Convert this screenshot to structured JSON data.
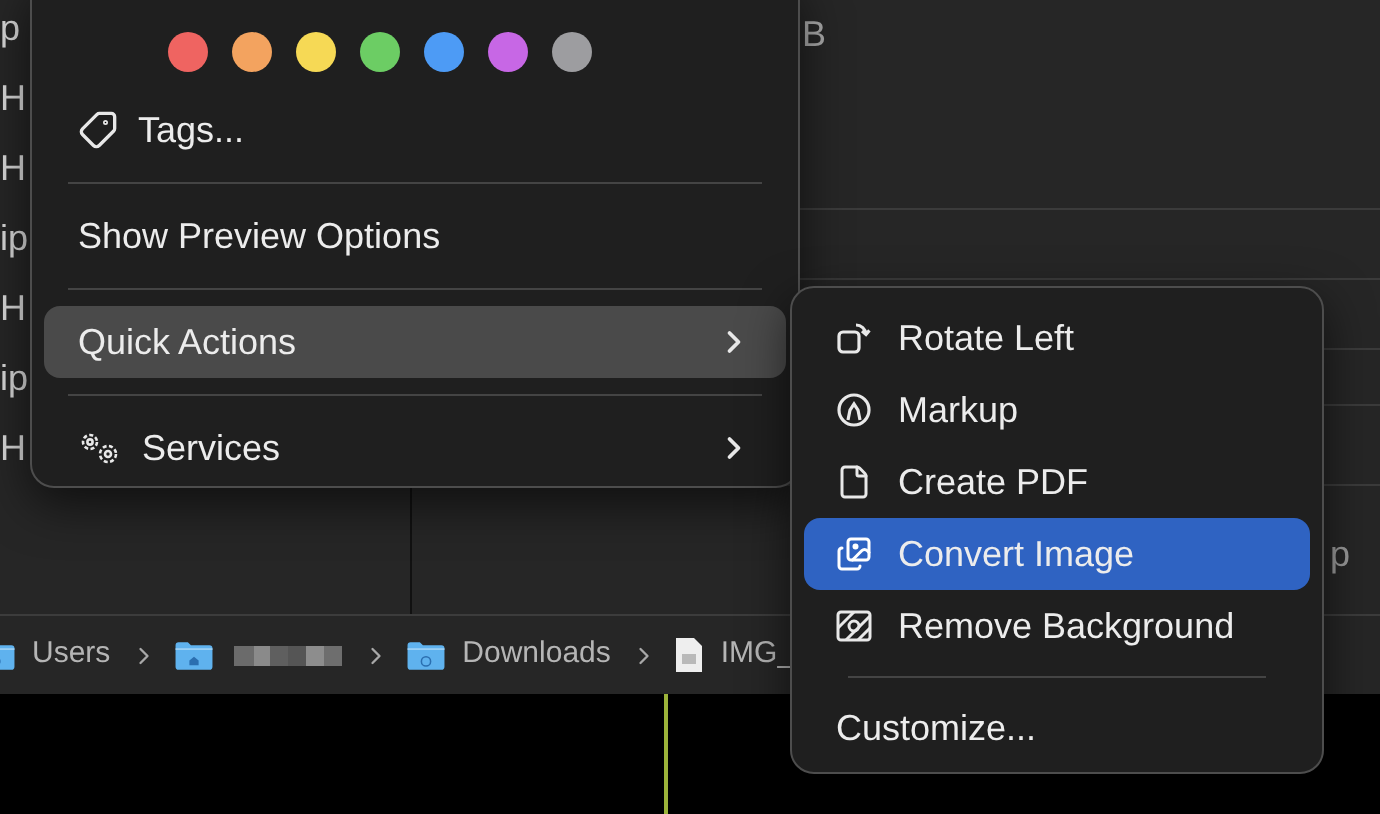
{
  "file_list": {
    "rows": [
      "p",
      "H",
      "H",
      "ip",
      "H",
      "ip",
      "H"
    ]
  },
  "column_fragment": "B",
  "right_pane_fragment": "p",
  "path_bar": {
    "items": [
      {
        "kind": "folder",
        "label": "Users"
      },
      {
        "kind": "home"
      },
      {
        "kind": "downloads",
        "label": "Downloads"
      },
      {
        "kind": "image",
        "label": "IMG_"
      }
    ]
  },
  "context_menu": {
    "tag_colors": [
      {
        "color": "#ef6461"
      },
      {
        "color": "#f3a35f"
      },
      {
        "color": "#f6d955"
      },
      {
        "color": "#6ccd64"
      },
      {
        "color": "#4d9bf5"
      },
      {
        "color": "#c767e5"
      },
      {
        "color": "#9d9da0"
      }
    ],
    "groups": [
      [
        {
          "kind": "tags",
          "label": "Tags...",
          "selected": false,
          "submenu": false
        }
      ],
      [
        {
          "kind": "plain",
          "label": "Show Preview Options",
          "selected": false,
          "submenu": false
        }
      ],
      [
        {
          "kind": "plain",
          "label": "Quick Actions",
          "selected": true,
          "submenu": true
        }
      ],
      [
        {
          "kind": "services",
          "label": "Services",
          "selected": false,
          "submenu": true
        }
      ]
    ]
  },
  "quick_actions_menu": {
    "groups": [
      [
        {
          "kind": "rotate",
          "label": "Rotate Left",
          "selected": false
        },
        {
          "kind": "markup",
          "label": "Markup",
          "selected": false
        },
        {
          "kind": "pdf",
          "label": "Create PDF",
          "selected": false
        },
        {
          "kind": "convert",
          "label": "Convert Image",
          "selected": true
        },
        {
          "kind": "remove-bg",
          "label": "Remove Background",
          "selected": false
        }
      ],
      [
        {
          "kind": "plain",
          "label": "Customize...",
          "selected": false
        }
      ]
    ]
  }
}
